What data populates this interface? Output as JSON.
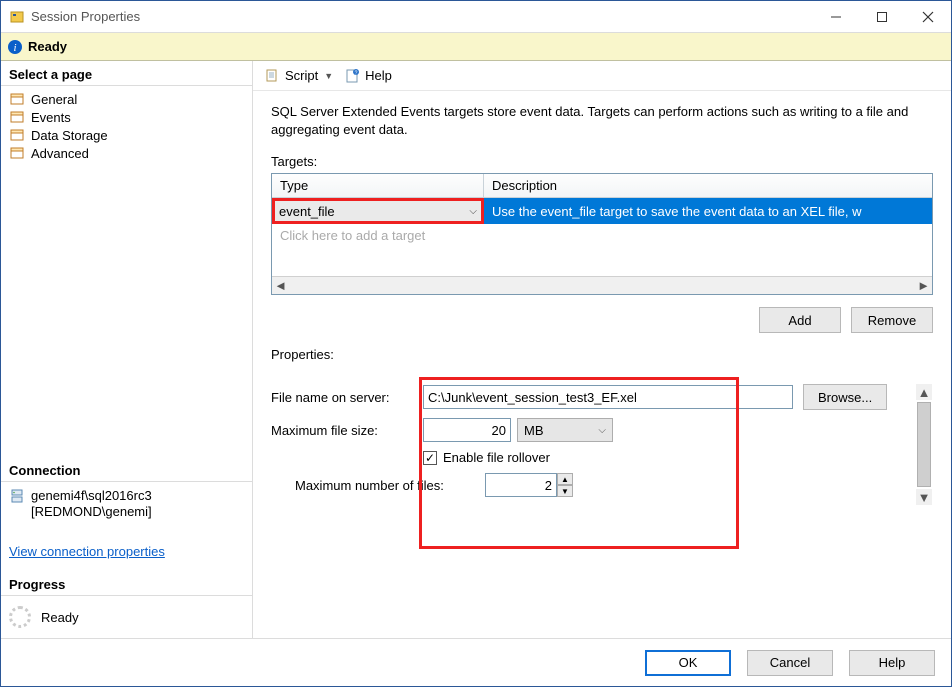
{
  "window": {
    "title": "Session Properties"
  },
  "status": {
    "text": "Ready"
  },
  "sidebar": {
    "select_page": "Select a page",
    "items": [
      {
        "label": "General"
      },
      {
        "label": "Events"
      },
      {
        "label": "Data Storage"
      },
      {
        "label": "Advanced"
      }
    ],
    "connection_header": "Connection",
    "connection_line1": "genemi4f\\sql2016rc3",
    "connection_line2": "[REDMOND\\genemi]",
    "view_connection": "View connection properties",
    "progress_header": "Progress",
    "progress_status": "Ready"
  },
  "toolbar": {
    "script": "Script",
    "help": "Help"
  },
  "content": {
    "intro": "SQL Server Extended Events targets store event data. Targets can perform actions such as writing to a file and aggregating event data.",
    "targets_label": "Targets:",
    "col_type": "Type",
    "col_description": "Description",
    "rows": [
      {
        "type": "event_file",
        "description": "Use the event_file target to save the event data to an XEL file, w"
      }
    ],
    "add_target_placeholder": "Click here to add a target",
    "add_btn": "Add",
    "remove_btn": "Remove",
    "properties_label": "Properties:",
    "file_name_label": "File name on server:",
    "file_name_value": "C:\\Junk\\event_session_test3_EF.xel",
    "browse_btn": "Browse...",
    "max_size_label": "Maximum file size:",
    "max_size_value": "20",
    "max_size_unit": "MB",
    "enable_rollover": "Enable file rollover",
    "max_files_label": "Maximum number of files:",
    "max_files_value": "2"
  },
  "footer": {
    "ok": "OK",
    "cancel": "Cancel",
    "help": "Help"
  }
}
